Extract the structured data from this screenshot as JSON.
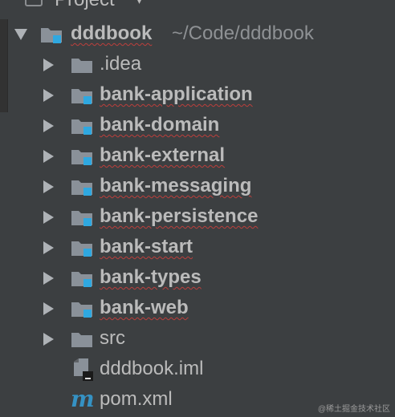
{
  "header": {
    "title": "Project",
    "dropdown_glyph": "▾",
    "icon": "project-view-icon"
  },
  "tree": {
    "root": {
      "name": "dddbook",
      "path": "~/Code/dddbook",
      "icon": "module-folder-icon"
    },
    "items": [
      {
        "label": "idea",
        "prefix": ".",
        "icon": "folder-icon"
      },
      {
        "label": "bank-application",
        "icon": "module-folder-icon"
      },
      {
        "label": "bank-domain",
        "icon": "module-folder-icon"
      },
      {
        "label": "bank-external",
        "icon": "module-folder-icon"
      },
      {
        "label": "bank-messaging",
        "icon": "module-folder-icon"
      },
      {
        "label": "bank-persistence",
        "icon": "module-folder-icon"
      },
      {
        "label": "bank-start",
        "icon": "module-folder-icon"
      },
      {
        "label": "bank-types",
        "icon": "module-folder-icon"
      },
      {
        "label": "bank-web",
        "icon": "module-folder-icon"
      },
      {
        "label": "src",
        "icon": "folder-icon"
      }
    ],
    "files": [
      {
        "label": "dddbook.iml",
        "icon": "iml-file-icon"
      },
      {
        "label": "pom.xml",
        "icon": "maven-icon",
        "glyph": "m"
      }
    ]
  },
  "colors": {
    "background": "#3c3f41",
    "text": "#bbbbbb",
    "folder": "#8a9199",
    "module_badge": "#2fa8e0",
    "spellcheck_underline": "#bc3f3c",
    "maven_blue": "#3592c4"
  },
  "watermark": "@稀土掘金技术社区"
}
